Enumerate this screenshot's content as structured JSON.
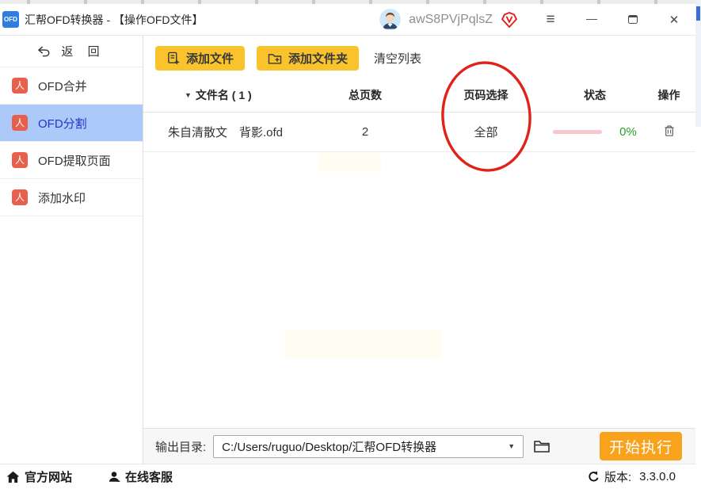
{
  "window": {
    "app_badge": "OFD",
    "title": "汇帮OFD转换器 - 【操作OFD文件】",
    "username": "awS8PVjPqlsZ"
  },
  "icons": {
    "menu": "≡",
    "minimize": "—",
    "close": "✕",
    "sort_caret": "▼",
    "dropdown_caret": "▼",
    "pdf_glyph": "人"
  },
  "sidebar": {
    "back": "返 回",
    "items": [
      {
        "label": "OFD合并"
      },
      {
        "label": "OFD分割"
      },
      {
        "label": "OFD提取页面"
      },
      {
        "label": "添加水印"
      }
    ],
    "active_item": "OFD分割"
  },
  "toolbar": {
    "add_file": "添加文件",
    "add_folder": "添加文件夹",
    "clear_list": "清空列表"
  },
  "table": {
    "headers": {
      "name": "文件名 ( 1 )",
      "pages": "总页数",
      "selection": "页码选择",
      "status": "状态",
      "action": "操作"
    },
    "rows": [
      {
        "name": "朱自清散文　背影.ofd",
        "pages": "2",
        "selection": "全部",
        "progress_percent": "0%"
      }
    ]
  },
  "output": {
    "label": "输出目录:",
    "path": "C:/Users/ruguo/Desktop/汇帮OFD转换器",
    "start": "开始执行"
  },
  "footer": {
    "official_site": "官方网站",
    "online_service": "在线客服",
    "version_label": "版本:",
    "version": "3.3.0.0"
  },
  "annotation": {
    "shape": "hand-drawn ellipse",
    "target": "页码选择 / 全部 column",
    "color": "#df2318"
  },
  "colors": {
    "accent_yellow": "#f8c32c",
    "accent_orange": "#f9a21b",
    "selected_blue_bg": "#abc9f9",
    "selected_blue_text": "#2435ce",
    "pdf_icon_red": "#e8604c",
    "progress_pink": "#f7c7cf",
    "percent_green": "#21a421",
    "annotation_red": "#df2318",
    "app_badge_blue": "#2f7de1"
  }
}
